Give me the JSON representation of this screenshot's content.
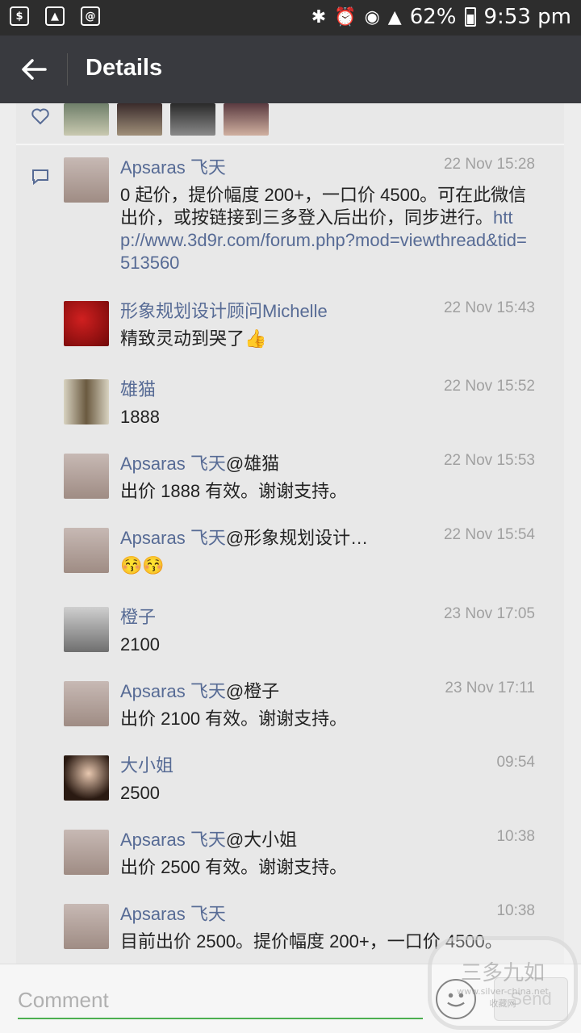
{
  "status_bar": {
    "battery": "62%",
    "time": "9:53 pm"
  },
  "app_bar": {
    "title": "Details"
  },
  "likes": {
    "count_shown": 4
  },
  "comments": [
    {
      "name": "Apsaras 飞天",
      "mention": "",
      "time": "22 Nov 15:28",
      "text": "0 起价，提价幅度 200+，一口价 4500。可在此微信出价，或按链接到三多登入后出价，同步进行。",
      "link": "http://www.3d9r.com/forum.php?mod=viewthread&tid=513560",
      "avatar_color": "#b9a7a0"
    },
    {
      "name": "形象规划设计顾问Michelle",
      "mention": "",
      "time": "22 Nov 15:43",
      "text": "精致灵动到哭了👍",
      "avatar_color": "#a01414"
    },
    {
      "name": "雄猫",
      "mention": "",
      "time": "22 Nov 15:52",
      "text": "1888",
      "avatar_color": "#8a7a5a"
    },
    {
      "name": "Apsaras 飞天",
      "mention": "@雄猫",
      "time": "22 Nov 15:53",
      "text": "出价 1888 有效。谢谢支持。",
      "avatar_color": "#b9a7a0"
    },
    {
      "name": "Apsaras 飞天",
      "mention": "@形象规划设计…",
      "time": "22 Nov 15:54",
      "text": "😚😚",
      "avatar_color": "#b9a7a0"
    },
    {
      "name": "橙子",
      "mention": "",
      "time": "23 Nov 17:05",
      "text": "2100",
      "avatar_color": "#9a9a9a"
    },
    {
      "name": "Apsaras 飞天",
      "mention": "@橙子",
      "time": "23 Nov 17:11",
      "text": "出价 2100 有效。谢谢支持。",
      "avatar_color": "#b9a7a0"
    },
    {
      "name": "大小姐",
      "mention": "",
      "time": "09:54",
      "text": "2500",
      "avatar_color": "#3a2a20"
    },
    {
      "name": "Apsaras 飞天",
      "mention": "@大小姐",
      "time": "10:38",
      "text": "出价 2500 有效。谢谢支持。",
      "avatar_color": "#b9a7a0"
    },
    {
      "name": "Apsaras 飞天",
      "mention": "",
      "time": "10:38",
      "text": "目前出价 2500。提价幅度 200+，一口价 4500。",
      "avatar_color": "#b9a7a0"
    }
  ],
  "input": {
    "placeholder": "Comment",
    "send_label": "Send"
  },
  "watermark": {
    "title": "三多九如",
    "url": "www.silver-china.net",
    "sub": "收藏网"
  },
  "colors": {
    "name": "#576b95",
    "accent": "#4caf50"
  }
}
